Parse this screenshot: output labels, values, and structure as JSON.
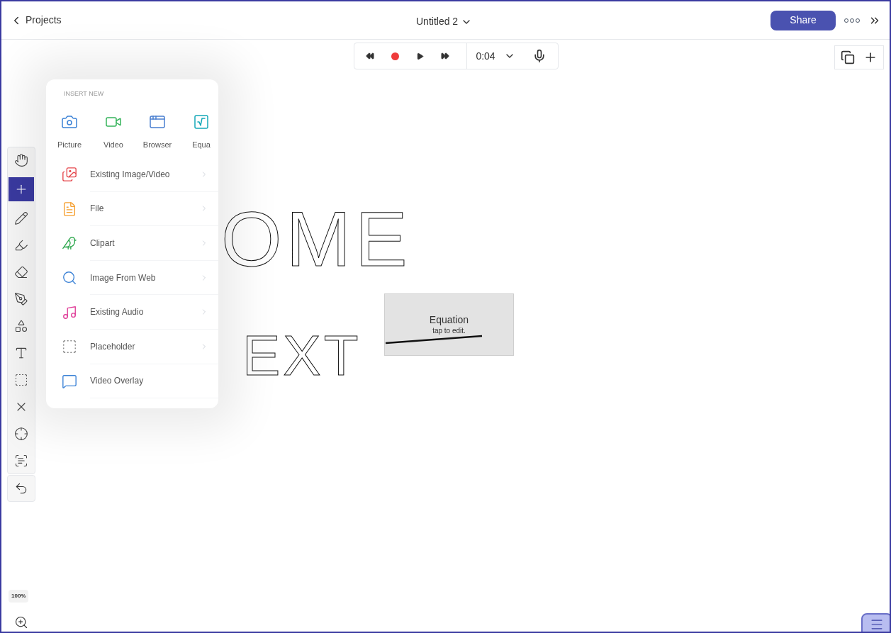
{
  "top_bar": {
    "back_label": "Projects",
    "title": "Untitled 2",
    "share_label": "Share"
  },
  "playback": {
    "time": "0:04",
    "recording": true
  },
  "tools": [
    {
      "selected": false
    },
    {
      "selected": true
    },
    {
      "selected": false
    },
    {
      "selected": false
    },
    {
      "selected": false
    },
    {
      "selected": false
    },
    {
      "selected": false
    },
    {
      "selected": false
    },
    {
      "selected": false
    },
    {
      "selected": false
    },
    {
      "selected": false
    },
    {
      "selected": false
    }
  ],
  "insert_menu": {
    "heading": "INSERT NEW",
    "quick": [
      {
        "label": "Picture"
      },
      {
        "label": "Video"
      },
      {
        "label": "Browser"
      },
      {
        "label": "Equa"
      }
    ],
    "items": [
      {
        "label": "Existing Image/Video",
        "has_submenu": true
      },
      {
        "label": "File",
        "has_submenu": true
      },
      {
        "label": "Clipart",
        "has_submenu": true
      },
      {
        "label": "Image From Web",
        "has_submenu": true
      },
      {
        "label": "Existing Audio",
        "has_submenu": true
      },
      {
        "label": "Placeholder",
        "has_submenu": true
      },
      {
        "label": "Video Overlay",
        "has_submenu": false
      }
    ]
  },
  "canvas": {
    "handwriting": [
      "OME",
      "EXT"
    ],
    "equation": {
      "title": "Equation",
      "hint": "tap to edit."
    }
  },
  "zoom": {
    "label": "100%"
  }
}
